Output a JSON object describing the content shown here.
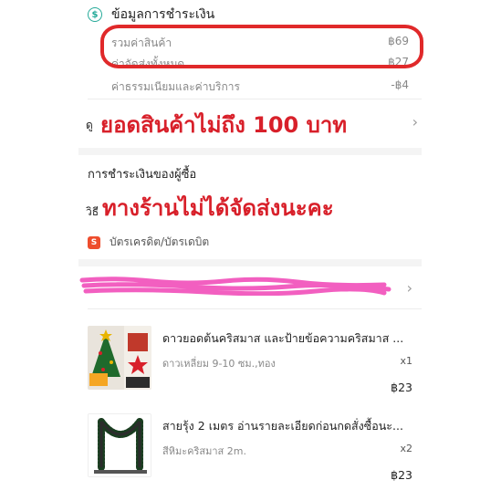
{
  "payment_info": {
    "title": "ข้อมูลการชำระเงิน",
    "icon": "dollar-icon",
    "rows": [
      {
        "label": "รวมค่าสินค้า",
        "value": "฿69"
      },
      {
        "label": "ค่าจัดส่งทั้งหมด",
        "value": "฿27"
      },
      {
        "label": "ค่าธรรมเนียมและค่าบริการ",
        "value": "-฿4"
      }
    ]
  },
  "annotations": {
    "line1": "ยอดสินค้าไม่ถึง  100 บาท",
    "line1_prefix": "ดู",
    "line2": "ทางร้านไม่ได้จัดส่งนะคะ",
    "line2_prefix": "วิธี"
  },
  "payment_method": {
    "title": "การชำระเงินของผู้ซื้อ",
    "card_label": "บัตรเครดิต/บัตรเดบิต",
    "card_icon": "card-shield-icon"
  },
  "products": [
    {
      "name": "ดาวยอดต้นคริสมาส และป้ายข้อความคริสมาส ...",
      "variant": "ดาวเหลี่ยม 9-10 ซม.,ทอง",
      "qty": "x1",
      "price": "฿23"
    },
    {
      "name": "สายรุ้ง 2 เมตร อ่านรายละเอียดก่อนกดสั่งซื้อนะ...",
      "variant": "สีหิมะคริสมาส 2m.",
      "qty": "x2",
      "price": "฿23"
    }
  ],
  "colors": {
    "annotation_red": "#d8202a",
    "accent_teal": "#26aa99",
    "card_orange": "#ee4d2d",
    "highlight_pink": "#f25fc0"
  }
}
